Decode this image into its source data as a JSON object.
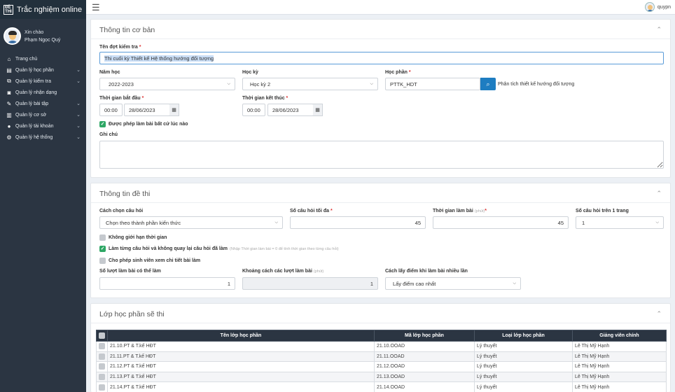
{
  "app": {
    "title": "Trắc nghiệm online",
    "logo_text": "ĐỀ THI"
  },
  "topbar": {
    "username": "quypn"
  },
  "sidebar": {
    "greeting": "Xin chào",
    "user_name": "Phạm Ngọc Quý",
    "items": [
      {
        "label": "Trang chủ",
        "icon": "home-icon",
        "glyph": "⌂",
        "has_children": false
      },
      {
        "label": "Quản lý học phần",
        "icon": "book-icon",
        "glyph": "▤",
        "has_children": true
      },
      {
        "label": "Quản lý kiểm tra",
        "icon": "clone-icon",
        "glyph": "⧉",
        "has_children": true
      },
      {
        "label": "Quản lý nhận dạng",
        "icon": "camera-icon",
        "glyph": "◙",
        "has_children": false
      },
      {
        "label": "Quản lý bài tập",
        "icon": "edit-icon",
        "glyph": "✎",
        "has_children": true
      },
      {
        "label": "Quản lý cơ sở",
        "icon": "building-icon",
        "glyph": "▥",
        "has_children": true
      },
      {
        "label": "Quản lý tài khoản",
        "icon": "user-icon",
        "glyph": "●",
        "has_children": true
      },
      {
        "label": "Quản lý hệ thống",
        "icon": "cogs-icon",
        "glyph": "⚙",
        "has_children": true
      }
    ],
    "chevron": "⌄"
  },
  "basic": {
    "title": "Thông tin cơ bản",
    "exam_name_label": "Tên đợt kiểm tra",
    "exam_name_value": "Thi cuối kỳ Thiết kế Hệ thống hướng đối tượng",
    "school_year_label": "Năm học",
    "school_year_value": "2022-2023",
    "semester_label": "Học kỳ",
    "semester_value": "Học kỳ 2",
    "course_label": "Học phần",
    "course_code": "PTTK_HDT",
    "course_name": "Phân tích thiết kế hướng đối tượng",
    "start_label": "Thời gian bắt đầu",
    "start_time": "00:00",
    "start_date": "28/06/2023",
    "end_label": "Thời gian kết thúc",
    "end_time": "00:00",
    "end_date": "28/06/2023",
    "allow_anytime_label": "Được phép làm bài bất cứ lúc nào",
    "note_label": "Ghi chú"
  },
  "exam": {
    "title": "Thông tin đề thi",
    "choose_method_label": "Cách chọn câu hỏi",
    "choose_method_value": "Chọn theo thành phần kiến thức",
    "max_questions_label": "Số câu hỏi tối đa",
    "max_questions_value": "45",
    "duration_label": "Thời gian làm bài",
    "duration_unit": "(phút)",
    "duration_value": "45",
    "per_page_label": "Số câu hỏi trên 1 trang",
    "per_page_value": "1",
    "no_time_limit_label": "Không giới hạn thời gian",
    "sequential_label": "Làm từng câu hỏi và không quay lại câu hỏi đã làm",
    "sequential_hint": "(Nhập Thời gian làm bài = 0 để tính thời gian theo từng câu hỏi)",
    "allow_view_label": "Cho phép sinh viên xem chi tiết bài làm",
    "attempts_label": "Số lượt làm bài có thể làm",
    "attempts_value": "1",
    "gap_label": "Khoảng cách các lượt làm bài",
    "gap_unit": "(phút)",
    "gap_value": "1",
    "score_method_label": "Cách lấy điểm khi làm bài nhiều lần",
    "score_method_value": "Lấy điểm cao nhất"
  },
  "classes": {
    "title": "Lớp học phần sẽ thi",
    "headers": [
      "Tên lớp học phần",
      "Mã lớp học phần",
      "Loại lớp học phần",
      "Giảng viên chính"
    ],
    "rows": [
      [
        "21.10.PT & T.kế HĐT",
        "21.10.OOAD",
        "Lý thuyết",
        "Lê Thị Mỹ Hạnh"
      ],
      [
        "21.11.PT & T.kế HĐT",
        "21.11.OOAD",
        "Lý thuyết",
        "Lê Thị Mỹ Hạnh"
      ],
      [
        "21.12.PT & T.kế HĐT",
        "21.12.OOAD",
        "Lý thuyết",
        "Lê Thị Mỹ Hạnh"
      ],
      [
        "21.13.PT & T.kế HĐT",
        "21.13.OOAD",
        "Lý thuyết",
        "Lê Thị Mỹ Hạnh"
      ],
      [
        "21.14.PT & T.kế HĐT",
        "21.14.OOAD",
        "Lý thuyết",
        "Lê Thị Mỹ Hạnh"
      ]
    ]
  },
  "glyphs": {
    "hamburger": "☰",
    "collapse": "⌃",
    "caret": "⌵",
    "calendar": "▦",
    "search": "⌕",
    "check": "✓"
  }
}
